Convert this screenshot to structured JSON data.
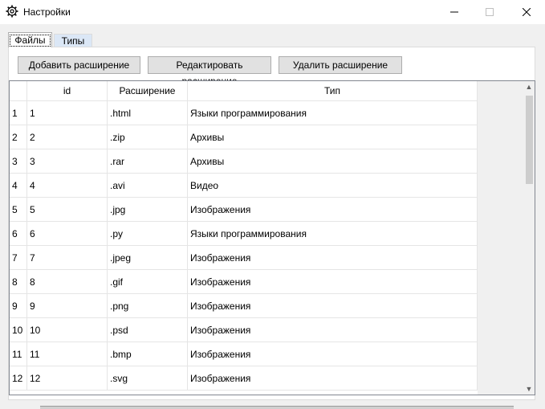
{
  "window": {
    "title": "Настройки"
  },
  "tabs": [
    {
      "label": "Файлы",
      "active": true
    },
    {
      "label": "Типы",
      "active": false
    }
  ],
  "toolbar": {
    "add_label": "Добавить расширение",
    "edit_label": "Редактировать расширение",
    "delete_label": "Удалить расширение"
  },
  "table": {
    "columns": [
      "id",
      "Расширение",
      "Тип"
    ],
    "rows": [
      {
        "num": "1",
        "id": "1",
        "ext": ".html",
        "type": "Языки программирования"
      },
      {
        "num": "2",
        "id": "2",
        "ext": ".zip",
        "type": "Архивы"
      },
      {
        "num": "3",
        "id": "3",
        "ext": ".rar",
        "type": "Архивы"
      },
      {
        "num": "4",
        "id": "4",
        "ext": ".avi",
        "type": "Видео"
      },
      {
        "num": "5",
        "id": "5",
        "ext": ".jpg",
        "type": "Изображения"
      },
      {
        "num": "6",
        "id": "6",
        "ext": ".py",
        "type": "Языки программирования"
      },
      {
        "num": "7",
        "id": "7",
        "ext": ".jpeg",
        "type": "Изображения"
      },
      {
        "num": "8",
        "id": "8",
        "ext": ".gif",
        "type": "Изображения"
      },
      {
        "num": "9",
        "id": "9",
        "ext": ".png",
        "type": "Изображения"
      },
      {
        "num": "10",
        "id": "10",
        "ext": ".psd",
        "type": "Изображения"
      },
      {
        "num": "11",
        "id": "11",
        "ext": ".bmp",
        "type": "Изображения"
      },
      {
        "num": "12",
        "id": "12",
        "ext": ".svg",
        "type": "Изображения"
      }
    ]
  },
  "icons": {
    "app": "gear-icon",
    "minimize": "minimize-icon",
    "maximize": "maximize-icon",
    "close": "close-icon",
    "scroll_up": "chevron-up-icon",
    "scroll_down": "chevron-down-icon"
  }
}
